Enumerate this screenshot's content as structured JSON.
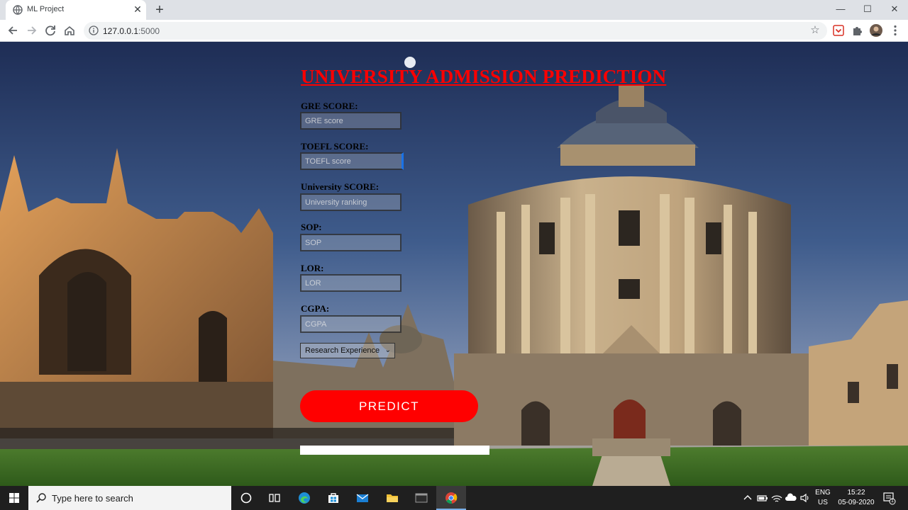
{
  "browser": {
    "tab_title": "ML Project",
    "url_host": "127.0.0.1",
    "url_port": ":5000",
    "close_glyph": "✕",
    "new_tab_glyph": "+",
    "bookmark_glyph": "☆"
  },
  "window_controls": {
    "minimize": "—",
    "maximize": "☐",
    "close": "✕"
  },
  "page": {
    "heading": "UNIVERSITY ADMISSION PREDICTION",
    "fields": [
      {
        "label": "GRE SCORE:",
        "placeholder": "GRE score"
      },
      {
        "label": "TOEFL SCORE:",
        "placeholder": "TOEFL score"
      },
      {
        "label": "University SCORE:",
        "placeholder": "University ranking"
      },
      {
        "label": "SOP:",
        "placeholder": "SOP"
      },
      {
        "label": "LOR:",
        "placeholder": "LOR"
      },
      {
        "label": "CGPA:",
        "placeholder": "CGPA"
      }
    ],
    "research_select": "Research Experience",
    "predict_button": "PREDICT"
  },
  "taskbar": {
    "search_placeholder": "Type here to search",
    "lang_line1": "ENG",
    "lang_line2": "US",
    "time": "15:22",
    "date": "05-09-2020",
    "notification_count": "1",
    "tray_icons": [
      "chevron-up-icon",
      "battery-icon",
      "wifi-icon",
      "cloud-icon",
      "volume-icon"
    ],
    "pinned_apps": [
      "cortana-icon",
      "task-view-icon",
      "edge-icon",
      "store-icon",
      "mail-icon",
      "file-explorer-icon",
      "terminal-icon",
      "chrome-icon"
    ]
  },
  "colors": {
    "heading": "#ff0000",
    "predict_button": "#ff0000",
    "accent_focus": "#1a73e8",
    "taskbar": "#1f1f1f"
  }
}
